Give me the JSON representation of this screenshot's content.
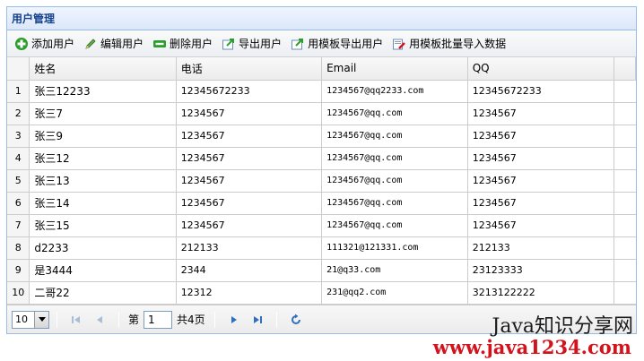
{
  "panel": {
    "title": "用户管理"
  },
  "toolbar": {
    "add": "添加用户",
    "edit": "编辑用户",
    "delete": "删除用户",
    "export": "导出用户",
    "template_export": "用模板导出用户",
    "template_import": "用模板批量导入数据"
  },
  "grid": {
    "columns": [
      "姓名",
      "电话",
      "Email",
      "QQ"
    ],
    "rows": [
      {
        "n": "1",
        "name": "张三12233",
        "phone": "12345672233",
        "email": "1234567@qq2233.com",
        "qq": "12345672233"
      },
      {
        "n": "2",
        "name": "张三7",
        "phone": "1234567",
        "email": "1234567@qq.com",
        "qq": "1234567"
      },
      {
        "n": "3",
        "name": "张三9",
        "phone": "1234567",
        "email": "1234567@qq.com",
        "qq": "1234567"
      },
      {
        "n": "4",
        "name": "张三12",
        "phone": "1234567",
        "email": "1234567@qq.com",
        "qq": "1234567"
      },
      {
        "n": "5",
        "name": "张三13",
        "phone": "1234567",
        "email": "1234567@qq.com",
        "qq": "1234567"
      },
      {
        "n": "6",
        "name": "张三14",
        "phone": "1234567",
        "email": "1234567@qq.com",
        "qq": "1234567"
      },
      {
        "n": "7",
        "name": "张三15",
        "phone": "1234567",
        "email": "1234567@qq.com",
        "qq": "1234567"
      },
      {
        "n": "8",
        "name": "d2233",
        "phone": "212133",
        "email": "111321@121331.com",
        "qq": "212133"
      },
      {
        "n": "9",
        "name": "是3444",
        "phone": "2344",
        "email": "21@q33.com",
        "qq": "23123333"
      },
      {
        "n": "10",
        "name": "二哥22",
        "phone": "12312",
        "email": "231@qq2.com",
        "qq": "3213122222"
      }
    ]
  },
  "pager": {
    "page_size": "10",
    "page_prefix": "第",
    "current_page": "1",
    "total_pages": "共4页"
  },
  "watermark": {
    "title": "Java知识分享网",
    "url": "www.java1234.com"
  }
}
